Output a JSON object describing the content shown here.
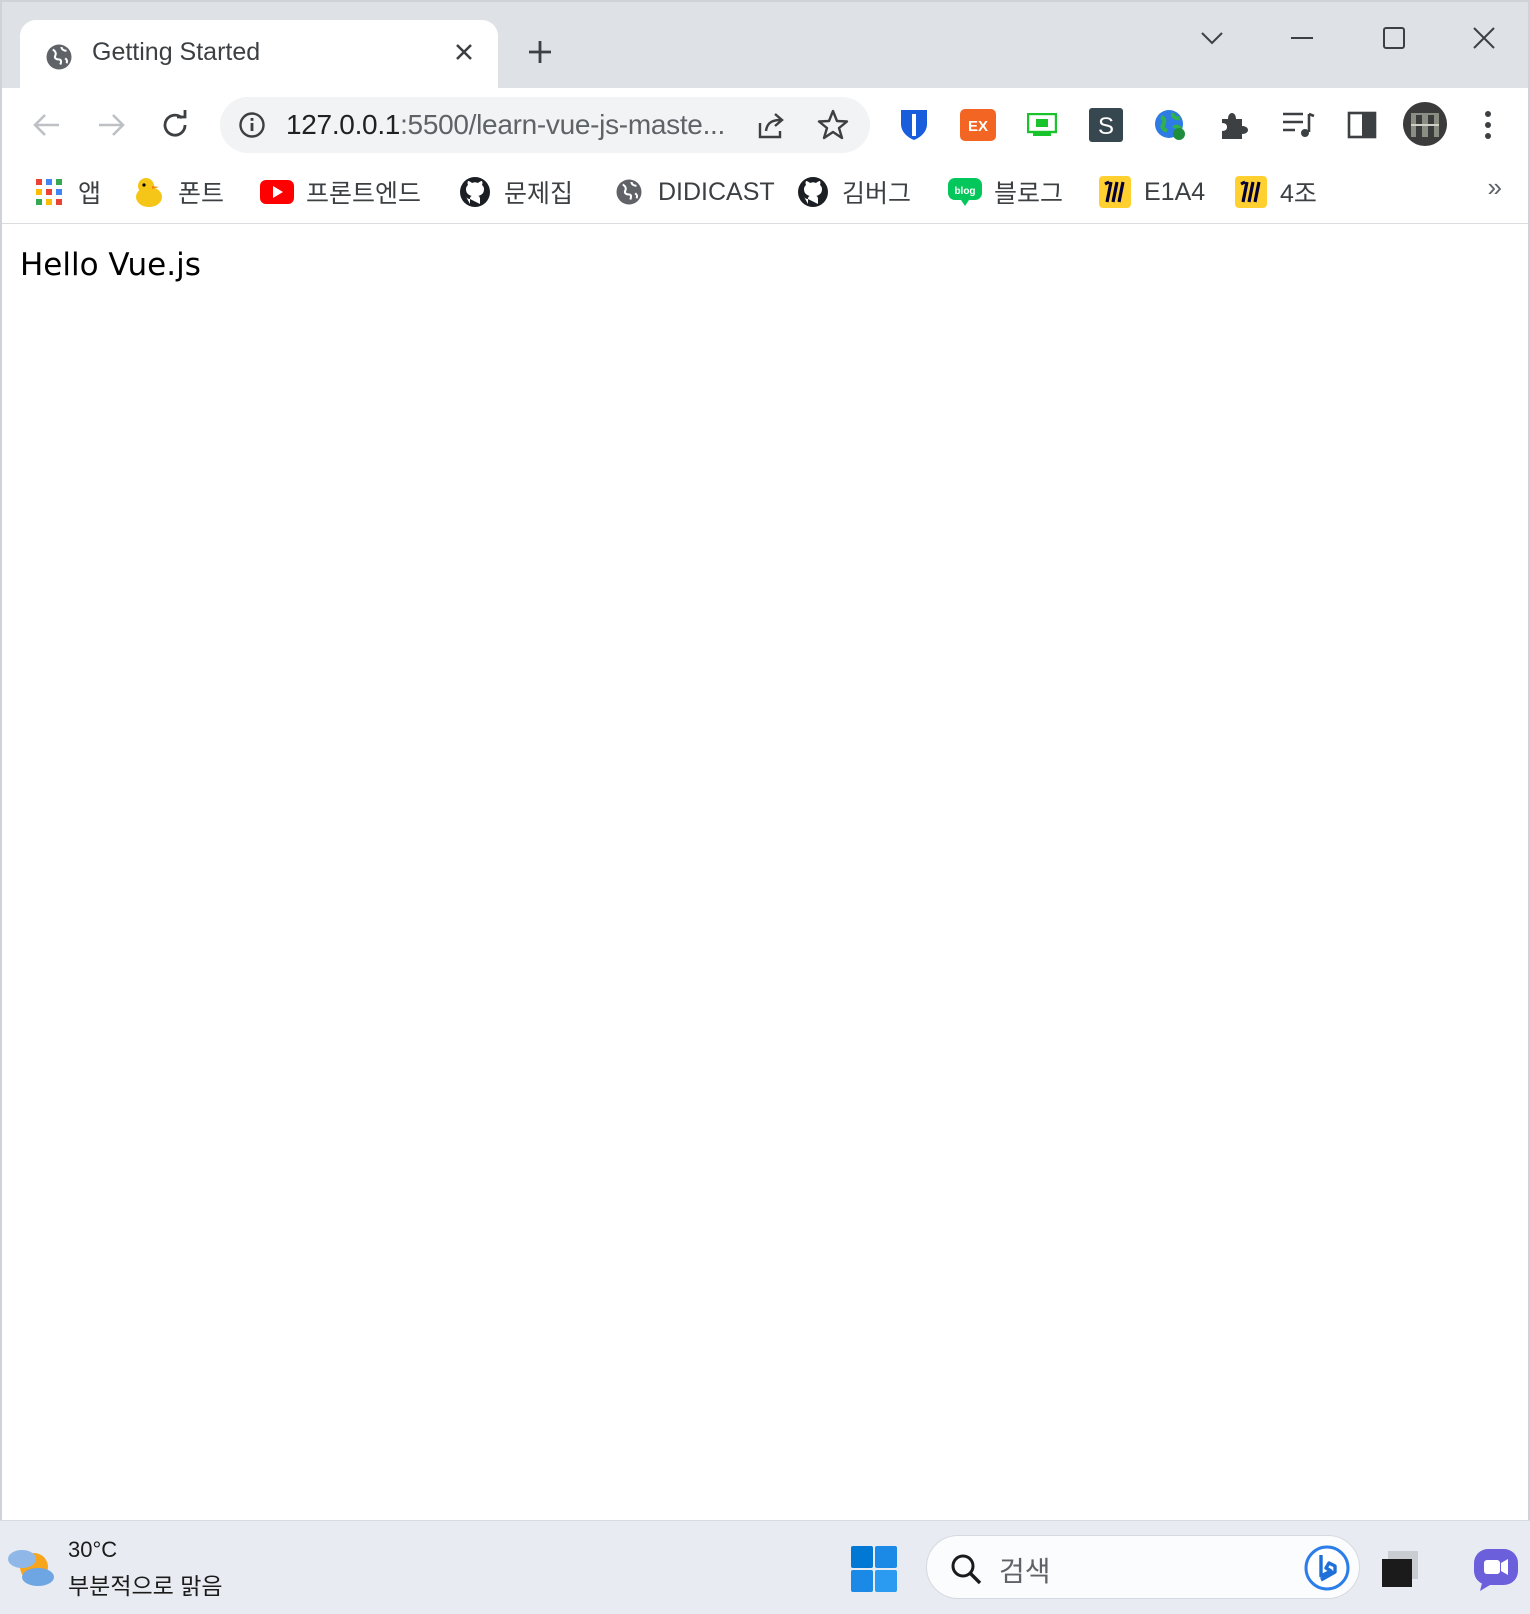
{
  "tab": {
    "title": "Getting Started"
  },
  "omnibox": {
    "url_host": "127.0.0.1",
    "url_path": ":5500/learn-vue-js-maste..."
  },
  "bookmarks": [
    {
      "label": "앱",
      "icon": "apps-grid-icon"
    },
    {
      "label": "폰트",
      "icon": "duck-icon"
    },
    {
      "label": "프론트엔드",
      "icon": "youtube-icon"
    },
    {
      "label": "문제집",
      "icon": "github-icon"
    },
    {
      "label": "DIDICAST",
      "icon": "globe-icon"
    },
    {
      "label": "김버그",
      "icon": "github-icon"
    },
    {
      "label": "블로그",
      "icon": "naver-blog-icon"
    },
    {
      "label": "E1A4",
      "icon": "miro-icon"
    },
    {
      "label": "4조",
      "icon": "miro-icon"
    }
  ],
  "bookmarks_more": "»",
  "page": {
    "heading": "Hello Vue.js"
  },
  "taskbar": {
    "weather_temp": "30°C",
    "weather_desc": "부분적으로 맑음",
    "search_placeholder": "검색"
  },
  "colors": {
    "tabstrip": "#dee1e6",
    "omnibox": "#f1f3f4",
    "taskbar": "#e8ecf2",
    "windows_blue": "#0078d4"
  }
}
